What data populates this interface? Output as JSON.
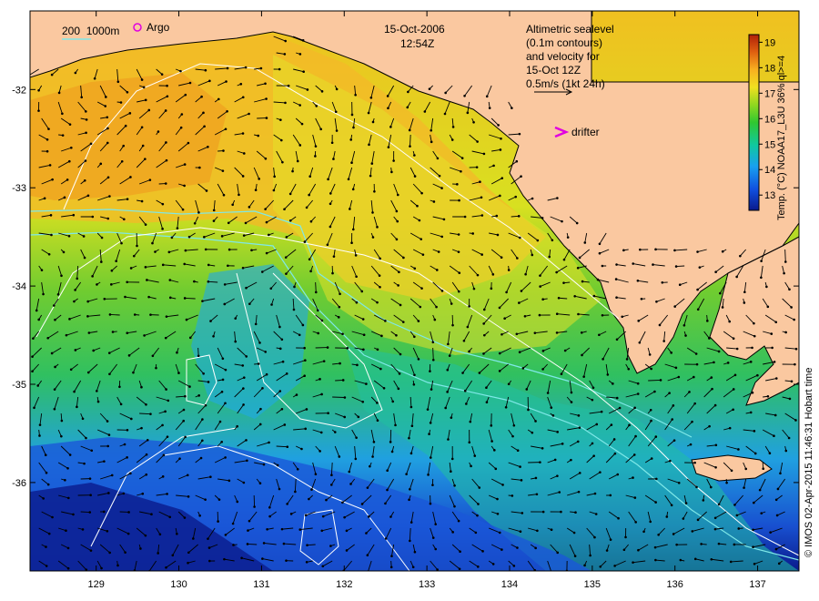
{
  "header": {
    "date": "15-Oct-2006",
    "time": "12:54Z"
  },
  "legend": {
    "isobaths": "200  1000m",
    "argo": "Argo",
    "drifter": "drifter",
    "altimetry_lines": [
      "Altimetric sealevel",
      "(0.1m contours)",
      "and velocity for",
      "15-Oct 12Z",
      "0.5m/s (1kt 24h)"
    ]
  },
  "colorbar": {
    "label": "Temp. (°C) NOAA17_L3U 36% ql>=4",
    "ticks": [
      "13",
      "14",
      "15",
      "16",
      "17",
      "18",
      "19"
    ],
    "colors": [
      "#0a1a8c",
      "#1050e0",
      "#18a0f0",
      "#10c8a0",
      "#30c830",
      "#90d820",
      "#f0e020",
      "#f8b020",
      "#e06010",
      "#b02008"
    ]
  },
  "credit": "© IMOS 02-Apr-2015 11:46:31 Hobart time",
  "map_data": {
    "x_ticks": [
      "129",
      "130",
      "131",
      "132",
      "133",
      "134",
      "135",
      "136",
      "137"
    ],
    "y_ticks": [
      "-32",
      "-33",
      "-34",
      "-35",
      "-36"
    ],
    "x_values": [
      129,
      130,
      131,
      132,
      133,
      134,
      135,
      136,
      137
    ],
    "y_values": [
      -32,
      -33,
      -34,
      -35,
      -36
    ],
    "lon_range": [
      128.2,
      137.5
    ],
    "lat_range": [
      -36.9,
      -31.2
    ],
    "colors": {
      "land": "#fac8a0",
      "isobath": "#7fe8e8",
      "sealevel_contour": "#ffffff",
      "arrow": "#000000",
      "argo_marker": "#e000e0",
      "drifter_marker": "#e000e0"
    }
  }
}
